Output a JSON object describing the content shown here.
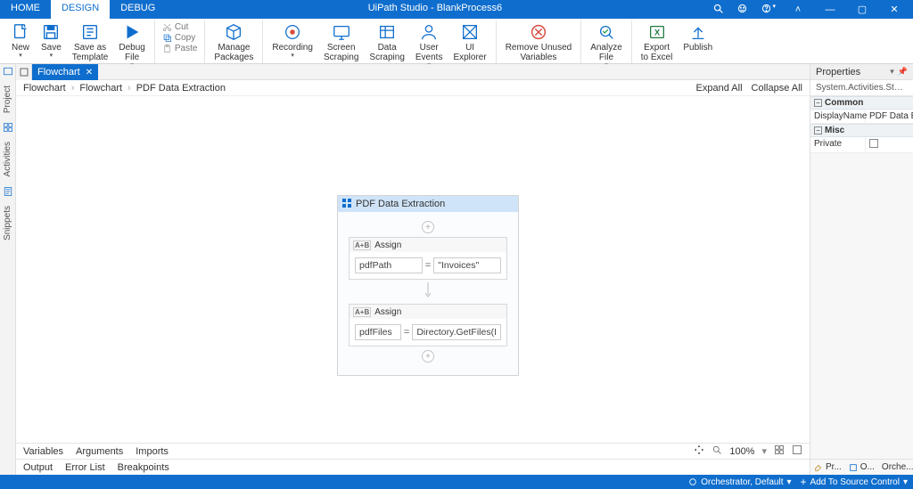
{
  "title": "UiPath Studio - BlankProcess6",
  "menu_tabs": [
    "HOME",
    "DESIGN",
    "DEBUG"
  ],
  "active_menu_tab": 1,
  "ribbon": {
    "new": "New",
    "save": "Save",
    "save_as_template": "Save as\nTemplate",
    "debug_file": "Debug\nFile",
    "cut": "Cut",
    "copy": "Copy",
    "paste": "Paste",
    "manage_packages": "Manage\nPackages",
    "recording": "Recording",
    "screen_scraping": "Screen\nScraping",
    "data_scraping": "Data\nScraping",
    "user_events": "User\nEvents",
    "ui_explorer": "UI\nExplorer",
    "remove_unused_variables": "Remove Unused\nVariables",
    "analyze_file": "Analyze\nFile",
    "export_to_excel": "Export\nto Excel",
    "publish": "Publish"
  },
  "left_rail": [
    "Project",
    "Activities",
    "Snippets"
  ],
  "doc_tab": "Flowchart",
  "breadcrumbs": [
    "Flowchart",
    "Flowchart",
    "PDF Data Extraction"
  ],
  "expand_all": "Expand All",
  "collapse_all": "Collapse All",
  "sequence": {
    "title": "PDF Data Extraction",
    "assigns": [
      {
        "label": "Assign",
        "left": "pdfPath",
        "right": "\"Invoices\""
      },
      {
        "label": "Assign",
        "left": "pdfFiles",
        "right": "Directory.GetFiles(I"
      }
    ]
  },
  "var_tabs": [
    "Variables",
    "Arguments",
    "Imports"
  ],
  "zoom": "100%",
  "bottom_tabs": [
    "Output",
    "Error List",
    "Breakpoints"
  ],
  "properties": {
    "header": "Properties",
    "type": "System.Activities.Statement...",
    "groups": [
      {
        "name": "Common",
        "rows": [
          {
            "k": "DisplayName",
            "v": "PDF Data E"
          }
        ]
      },
      {
        "name": "Misc",
        "rows": [
          {
            "k": "Private",
            "v": "__checkbox__"
          }
        ]
      }
    ],
    "bottom_tabs": [
      "Pr...",
      "O...",
      "Orche..."
    ]
  },
  "statusbar": {
    "orchestrator": "Orchestrator, Default",
    "source_control": "Add To Source Control"
  }
}
